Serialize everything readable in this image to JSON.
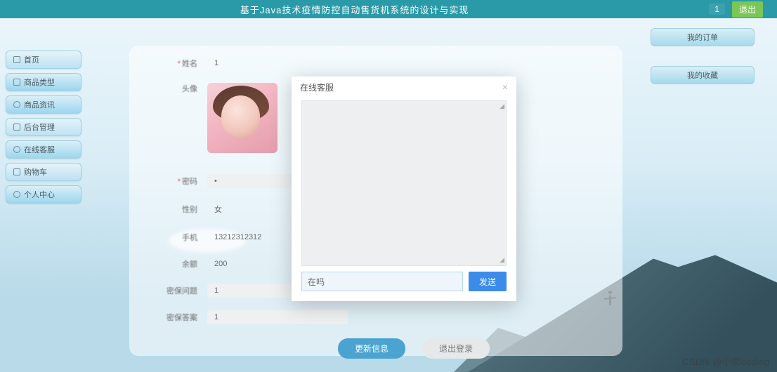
{
  "header": {
    "title": "基于Java技术疫情防控自动售货机系统的设计与实现",
    "badge": "1",
    "exit_label": "退出"
  },
  "sidebar": {
    "items": [
      {
        "icon": "home-icon",
        "label": "首页"
      },
      {
        "icon": "category-icon",
        "label": "商品类型"
      },
      {
        "icon": "info-icon",
        "label": "商品资讯"
      },
      {
        "icon": "admin-icon",
        "label": "后台管理"
      },
      {
        "icon": "service-icon",
        "label": "在线客服"
      },
      {
        "icon": "cart-icon",
        "label": "购物车"
      },
      {
        "icon": "user-icon",
        "label": "个人中心"
      }
    ]
  },
  "right_pills": {
    "items": [
      {
        "label": "我的订单"
      },
      {
        "label": "我的收藏"
      }
    ]
  },
  "form": {
    "nickname_label": "姓名",
    "nickname_value": "1",
    "avatar_label": "头像",
    "password_label": "密码",
    "password_value": "•",
    "gender_label": "性别",
    "gender_value": "女",
    "phone_label": "手机",
    "phone_value": "13212312312",
    "balance_label": "余额",
    "balance_value": "200",
    "secq_label": "密保问题",
    "secq_value": "1",
    "seca_label": "密保答案",
    "seca_value": "1",
    "save_label": "更新信息",
    "logout_label": "退出登录"
  },
  "modal": {
    "title": "在线客服",
    "input_value": "在吗",
    "send_label": "发送"
  },
  "watermark": "CSDN @小崇coding",
  "colors": {
    "accent": "#3b8bea",
    "topbar": "#2a9aa8"
  }
}
